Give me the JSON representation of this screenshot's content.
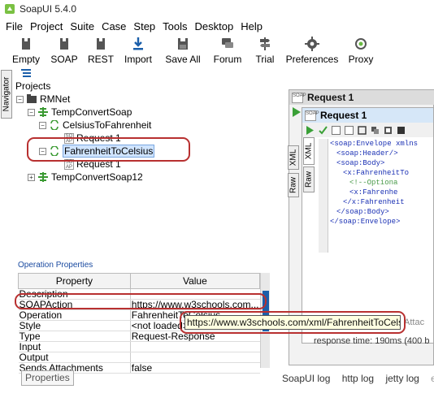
{
  "window": {
    "title": "SoapUI 5.4.0"
  },
  "menu": [
    "File",
    "Project",
    "Suite",
    "Case",
    "Step",
    "Tools",
    "Desktop",
    "Help"
  ],
  "toolbar": [
    "Empty",
    "SOAP",
    "REST",
    "Import",
    "Save All",
    "Forum",
    "Trial",
    "Preferences",
    "Proxy"
  ],
  "navigator": {
    "tab_label": "Navigator"
  },
  "tree": {
    "root_label": "Projects",
    "items": [
      {
        "label": "RMNet"
      },
      {
        "label": "TempConvertSoap"
      },
      {
        "label": "CelsiusToFahrenheit"
      },
      {
        "label": "Request 1"
      },
      {
        "label": "FahrenheitToCelsius"
      },
      {
        "label": "Request 1"
      },
      {
        "label": "TempConvertSoap12"
      }
    ]
  },
  "operation_properties": {
    "header": "Operation Properties",
    "columns": [
      "Property",
      "Value"
    ],
    "rows": [
      {
        "property": "Description",
        "value": ""
      },
      {
        "property": "SOAPAction",
        "value": "https://www.w3schools.com..."
      },
      {
        "property": "Operation",
        "value": "FahrenheitToCelsius"
      },
      {
        "property": "Style",
        "value": "<not loaded>"
      },
      {
        "property": "Type",
        "value": "Request-Response"
      },
      {
        "property": "Input",
        "value": ""
      },
      {
        "property": "Output",
        "value": ""
      },
      {
        "property": "Sends Attachments",
        "value": "false"
      }
    ],
    "properties_button": "Properties"
  },
  "tooltip": {
    "text": "https://www.w3schools.com/xml/FahrenheitToCelsius"
  },
  "request_outer": {
    "title": "Request 1",
    "badge": "SOAP"
  },
  "request_inner": {
    "title": "Request 1",
    "tabs": [
      "XML",
      "Raw"
    ],
    "raw_tab": "Raw",
    "xml_lines": [
      "<soap:Envelope xmlns",
      "<soap:Header/>",
      "<soap:Body>",
      "<x:FahrenheitTo",
      "<!--Optiona",
      "<x:Fahrenhe",
      "</x:Fahrenheit",
      "</soap:Body>",
      "</soap:Envelope>"
    ],
    "response_time": "response time: 190ms (400 b",
    "attach_fragment": "Attac"
  },
  "log_tabs": [
    "SoapUI log",
    "http log",
    "jetty log",
    "er"
  ]
}
